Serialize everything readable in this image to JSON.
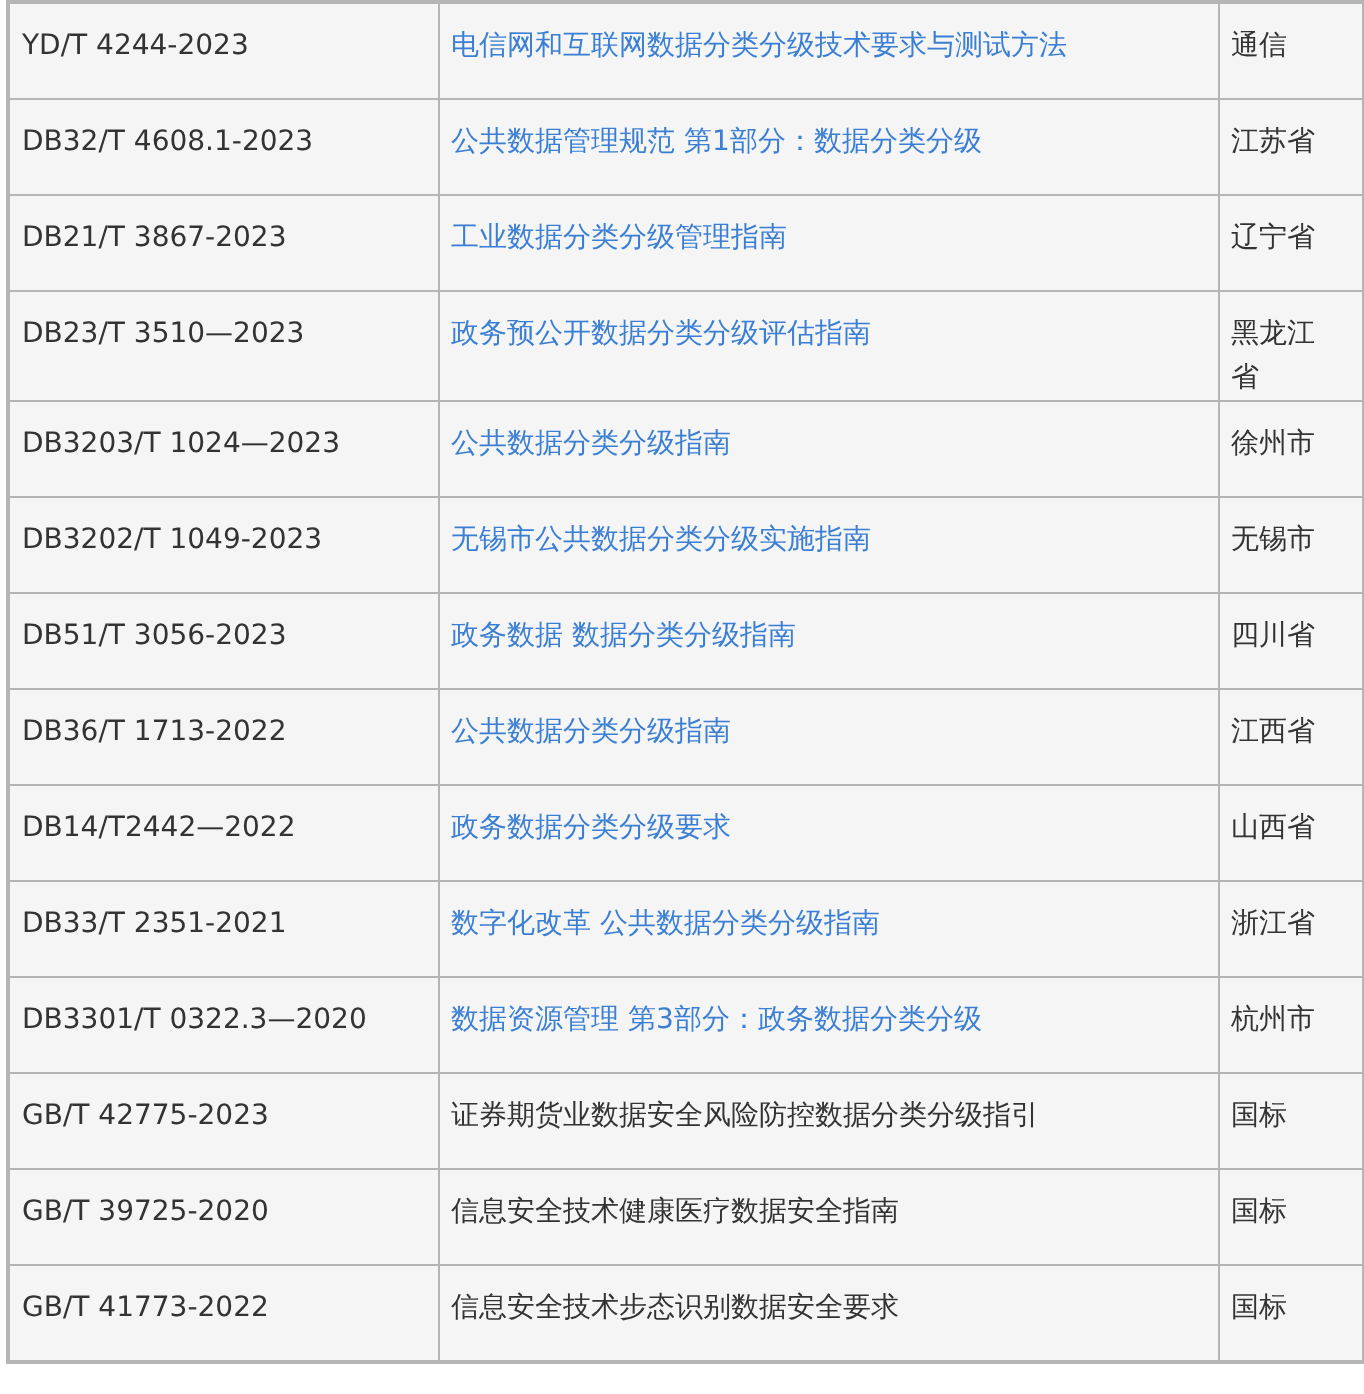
{
  "table": {
    "rows": [
      {
        "code": "YD/T 4244-2023",
        "title": "电信网和互联网数据分类分级技术要求与测试方法",
        "kind": "link",
        "scope": "通信"
      },
      {
        "code": "DB32/T 4608.1-2023",
        "title": "公共数据管理规范 第1部分：数据分类分级",
        "kind": "link",
        "scope": "江苏省"
      },
      {
        "code": "DB21/T 3867-2023",
        "title": "工业数据分类分级管理指南",
        "kind": "link",
        "scope": "辽宁省"
      },
      {
        "code": "DB23/T 3510—2023",
        "title": "政务预公开数据分类分级评估指南",
        "kind": "link",
        "scope": "黑龙江省"
      },
      {
        "code": "DB3203/T 1024—2023",
        "title": "公共数据分类分级指南",
        "kind": "link",
        "scope": "徐州市"
      },
      {
        "code": "DB3202/T 1049-2023",
        "title": "无锡市公共数据分类分级实施指南",
        "kind": "link",
        "scope": "无锡市"
      },
      {
        "code": "DB51/T 3056-2023",
        "title": "政务数据 数据分类分级指南",
        "kind": "link",
        "scope": "四川省"
      },
      {
        "code": "DB36/T 1713-2022",
        "title": "公共数据分类分级指南",
        "kind": "link",
        "scope": "江西省"
      },
      {
        "code": "DB14/T2442—2022",
        "title": "政务数据分类分级要求",
        "kind": "link",
        "scope": "山西省"
      },
      {
        "code": "DB33/T 2351-2021",
        "title": "数字化改革 公共数据分类分级指南",
        "kind": "link",
        "scope": "浙江省"
      },
      {
        "code": "DB3301/T 0322.3—2020",
        "title": "数据资源管理 第3部分：政务数据分类分级",
        "kind": "link",
        "scope": "杭州市"
      },
      {
        "code": "GB/T 42775-2023",
        "title": "证券期货业数据安全风险防控数据分类分级指引",
        "kind": "text",
        "scope": "国标"
      },
      {
        "code": "GB/T 39725-2020",
        "title": "信息安全技术健康医疗数据安全指南",
        "kind": "text",
        "scope": "国标"
      },
      {
        "code": "GB/T 41773-2022",
        "title": "信息安全技术步态识别数据安全要求",
        "kind": "text",
        "scope": "国标"
      }
    ]
  }
}
